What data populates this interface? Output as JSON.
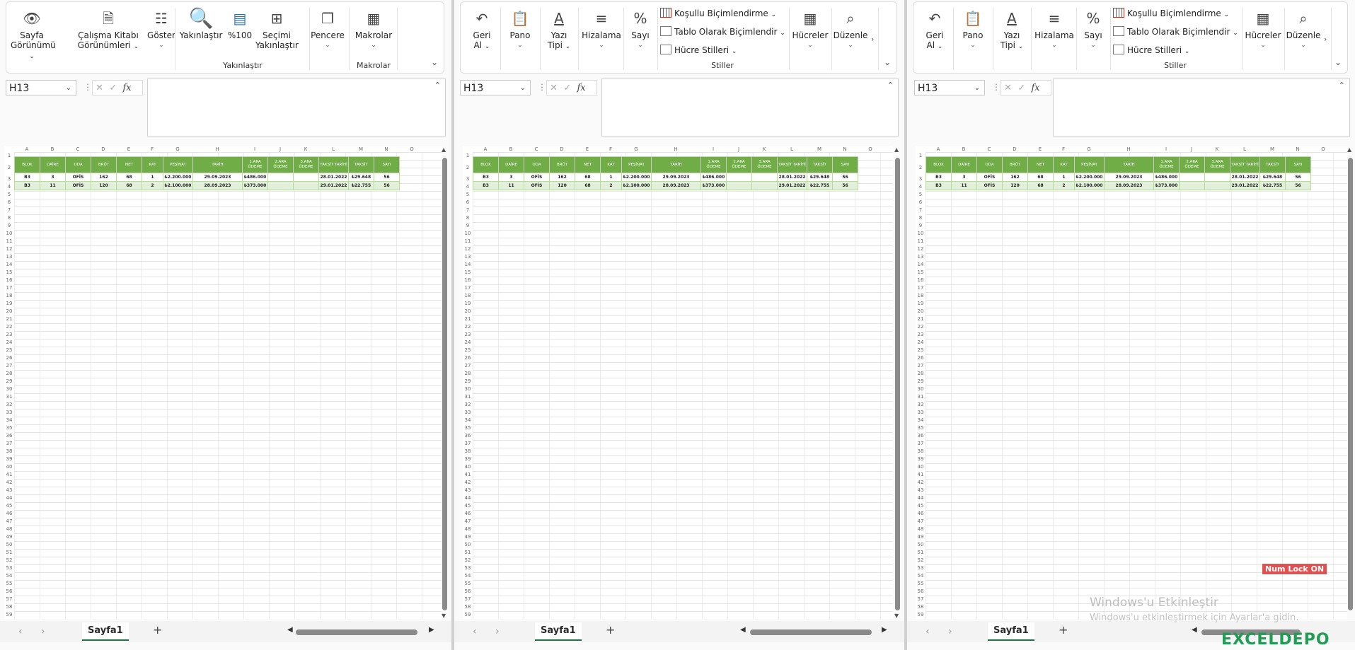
{
  "ribbon_left": {
    "groups": [
      {
        "title": ""
      },
      {
        "title": "Yakınlaştır"
      },
      {
        "title": "Makrolar"
      }
    ],
    "buttons": {
      "sayfa": [
        "Sayfa",
        "Görünümü"
      ],
      "calisma": [
        "Çalışma Kitabı",
        "Görünümleri"
      ],
      "goster": "Göster",
      "yakinlastir": "Yakınlaştır",
      "yuzde": "%100",
      "secimi": [
        "Seçimi",
        "Yakınlaştır"
      ],
      "pencere": "Pencere",
      "makrolar": "Makrolar"
    }
  },
  "ribbon_home": {
    "geri": [
      "Geri",
      "Al"
    ],
    "pano": "Pano",
    "yazi": [
      "Yazı",
      "Tipi"
    ],
    "hizalama": "Hizalama",
    "sayi": "Sayı",
    "kosullu": "Koşullu Biçimlendirme",
    "tablo": "Tablo Olarak Biçimlendir",
    "hucre_stilleri": "Hücre Stilleri",
    "stiller": "Stiller",
    "hucreler": "Hücreler",
    "duzenle": "Düzenle"
  },
  "namebox": "H13",
  "fx": "fx",
  "columns": [
    "A",
    "B",
    "C",
    "D",
    "E",
    "F",
    "G",
    "H",
    "I",
    "J",
    "K",
    "L",
    "M",
    "N",
    "O"
  ],
  "table": {
    "headers": [
      "BLOK",
      "DAİRE",
      "ODA",
      "BRÜT",
      "NET",
      "KAT",
      "PEŞİNAT",
      "TARİH",
      "1.ARA ÖDEME",
      "2.ARA ÖDEME",
      "3.ARA ÖDEME",
      "TAKSİT TARİHİ",
      "TAKSİT",
      "SAYI"
    ],
    "rows": [
      [
        "B3",
        "3",
        "OFİS",
        "162",
        "68",
        "1",
        "₺2.200.000",
        "29.09.2023",
        "₺486.000",
        "",
        "",
        "28.01.2022",
        "₺29.648",
        "56"
      ],
      [
        "B3",
        "11",
        "OFİS",
        "120",
        "68",
        "2",
        "₺2.100.000",
        "28.09.2023",
        "₺373.000",
        "",
        "",
        "29.01.2022",
        "₺22.755",
        "56"
      ]
    ]
  },
  "sheet_tab": "Sayfa1",
  "numlock": "Num Lock ON",
  "watermark": {
    "line1": "Windows'u Etkinleştir",
    "line2": "Windows'u etkinleştirmek için Ayarlar'a gidin."
  },
  "logo": "EXCELDEPO"
}
